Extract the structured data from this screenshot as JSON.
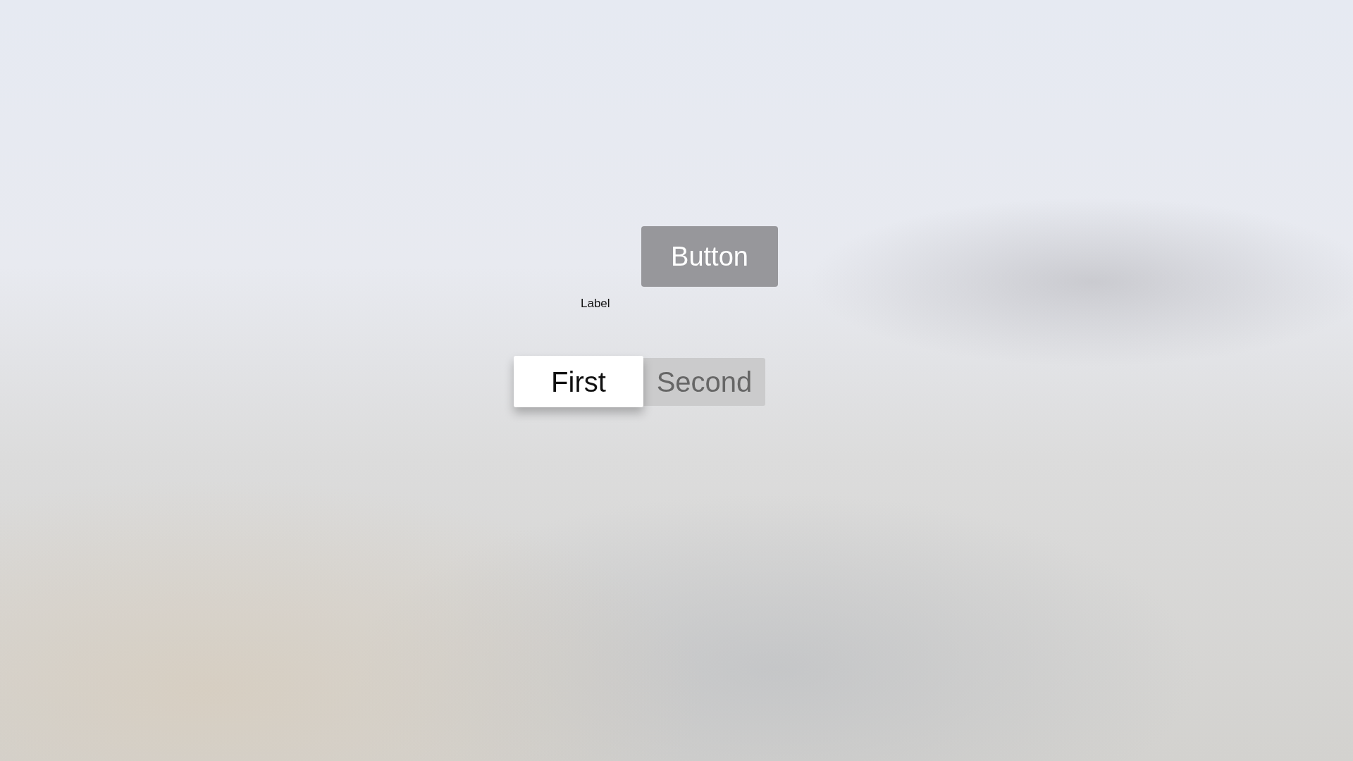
{
  "button": {
    "label": "Button"
  },
  "label": "Label",
  "segments": [
    {
      "label": "First",
      "selected": true
    },
    {
      "label": "Second",
      "selected": false
    }
  ]
}
